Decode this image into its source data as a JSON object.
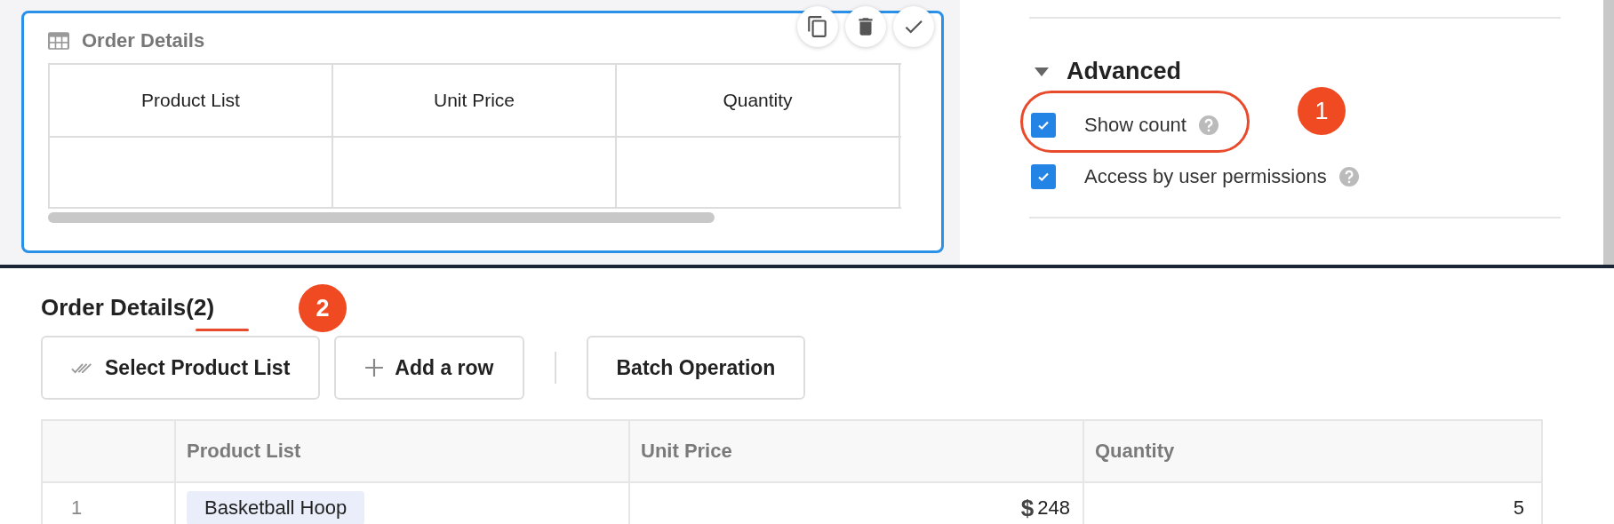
{
  "editor_card": {
    "title": "Order Details",
    "columns": [
      "Product List",
      "Unit Price",
      "Quantity"
    ]
  },
  "settings": {
    "section": {
      "title": "Advanced",
      "expanded": true
    },
    "options": [
      {
        "label": "Show count",
        "checked": true,
        "highlighted": true,
        "badge": "1"
      },
      {
        "label": "Access by user permissions",
        "checked": true,
        "highlighted": false
      }
    ]
  },
  "subtable": {
    "title": "Order Details",
    "count": "(2)",
    "count_underlined": true,
    "badge": "2",
    "buttons": [
      {
        "label": "Select Product List",
        "kind": "select"
      },
      {
        "label": "Add a row",
        "kind": "add"
      },
      {
        "label": "Batch Operation",
        "kind": "plain"
      }
    ],
    "columns": [
      "Product List",
      "Unit Price",
      "Quantity"
    ],
    "rows": [
      {
        "index": "1",
        "product": "Basketball Hoop",
        "currency": "$",
        "price": "248",
        "quantity": "5"
      }
    ]
  }
}
